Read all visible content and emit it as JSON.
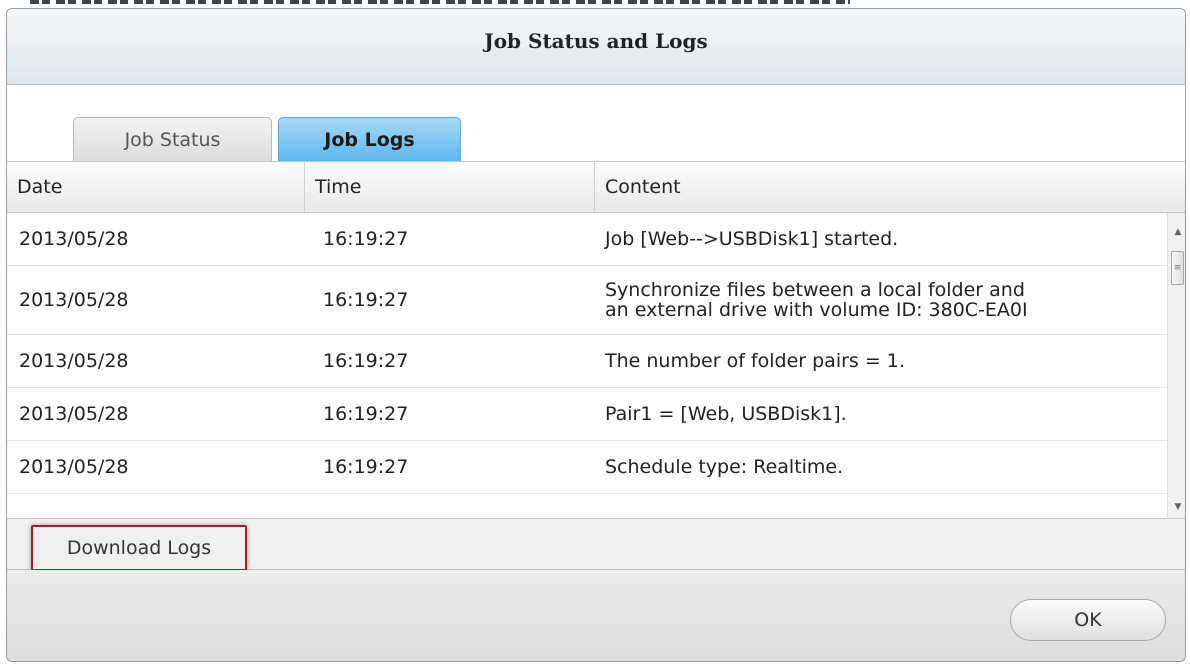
{
  "dialog": {
    "title": "Job Status and Logs"
  },
  "tabs": [
    {
      "label": "Job Status",
      "active": false
    },
    {
      "label": "Job Logs",
      "active": true
    }
  ],
  "table": {
    "columns": [
      "Date",
      "Time",
      "Content"
    ],
    "rows": [
      {
        "date": "2013/05/28",
        "time": "16:19:27",
        "content": [
          "Job [Web-->USBDisk1] started."
        ]
      },
      {
        "date": "2013/05/28",
        "time": "16:19:27",
        "content": [
          "Synchronize files between a local folder and",
          "an external drive with volume ID: 380C-EA0I"
        ]
      },
      {
        "date": "2013/05/28",
        "time": "16:19:27",
        "content": [
          "The number of folder pairs = 1."
        ]
      },
      {
        "date": "2013/05/28",
        "time": "16:19:27",
        "content": [
          "Pair1 = [Web, USBDisk1]."
        ]
      },
      {
        "date": "2013/05/28",
        "time": "16:19:27",
        "content": [
          "Schedule type: Realtime."
        ]
      }
    ]
  },
  "footer": {
    "download_label": "Download Logs",
    "ok_label": "OK"
  },
  "icons": {
    "scroll_up": "scroll-up-arrow-icon",
    "scroll_down": "scroll-down-arrow-icon",
    "scroll_thumb_grip": "scroll-grip-icon"
  },
  "colors": {
    "active_tab": "#5cb7ef",
    "highlight_border": "#a31c2b"
  }
}
